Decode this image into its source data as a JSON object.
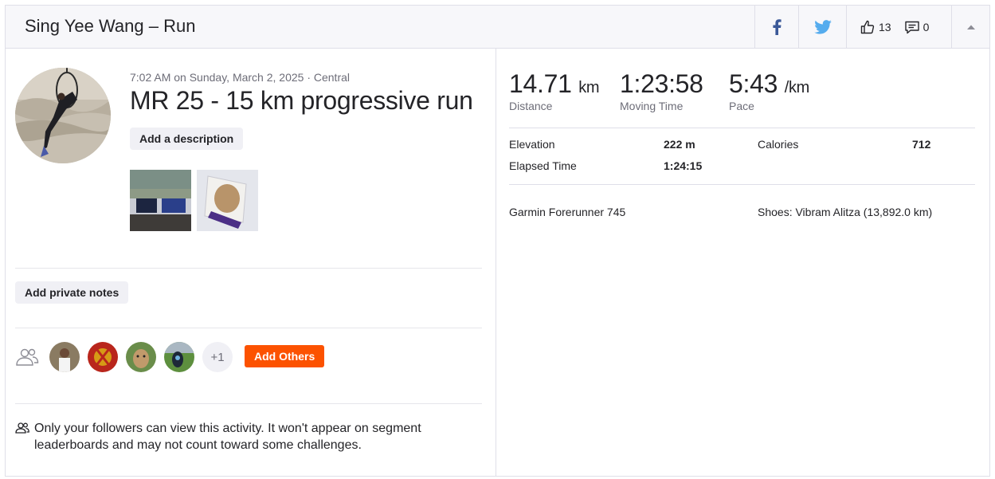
{
  "header": {
    "title": "Sing Yee Wang – Run",
    "kudos_count": "13",
    "comment_count": "0"
  },
  "activity": {
    "datetime": "7:02 AM on Sunday, March 2, 2025 · Central",
    "title": "MR 25 - 15 km progressive run",
    "add_description_label": "Add a description",
    "add_private_notes_label": "Add private notes",
    "plus_more": "+1",
    "add_others_label": "Add Others",
    "privacy_text": "Only your followers can view this activity. It won't appear on segment leaderboards and may not count toward some challenges."
  },
  "stats": {
    "distance_value": "14.71",
    "distance_unit": "km",
    "distance_label": "Distance",
    "moving_time_value": "1:23:58",
    "moving_time_label": "Moving Time",
    "pace_value": "5:43",
    "pace_unit": "/km",
    "pace_label": "Pace",
    "elevation_label": "Elevation",
    "elevation_value": "222 m",
    "calories_label": "Calories",
    "calories_value": "712",
    "elapsed_label": "Elapsed Time",
    "elapsed_value": "1:24:15",
    "device": "Garmin Forerunner 745",
    "shoes": "Shoes: Vibram Alitza (13,892.0 km)"
  },
  "colors": {
    "accent": "#fc5200",
    "facebook": "#3b5998",
    "twitter": "#55acee",
    "border": "#dfdfe8",
    "muted_text": "#6d6d78"
  },
  "icons": [
    "facebook-icon",
    "twitter-icon",
    "thumbs-up-icon",
    "comment-icon",
    "chevron-up-icon",
    "group-icon",
    "followers-icon"
  ]
}
